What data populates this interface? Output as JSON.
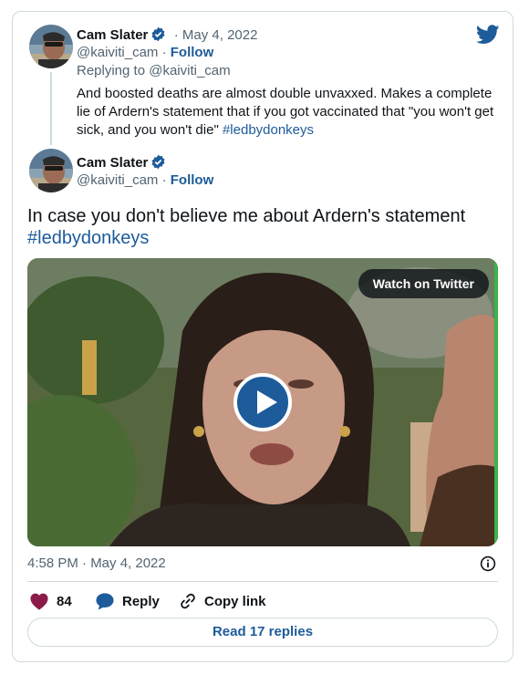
{
  "colors": {
    "accent": "#1d5b9a",
    "like": "#8b1c4a",
    "muted": "#536471",
    "border": "#cfd9de"
  },
  "reply_tweet": {
    "author_name": "Cam Slater",
    "date": "May 4, 2022",
    "handle": "@kaiviti_cam",
    "follow_label": "Follow",
    "replying_to": "Replying to @kaiviti_cam",
    "text": "And boosted deaths are almost double unvaxxed. Makes a complete lie of Ardern's statement that if you got vaccinated that \"you won't get sick, and you won't die\"",
    "hashtag": "#ledbydonkeys"
  },
  "main_tweet": {
    "author_name": "Cam Slater",
    "handle": "@kaiviti_cam",
    "follow_label": "Follow",
    "text": "In case you don't believe me about Ardern's statement",
    "hashtag": "#ledbydonkeys",
    "video": {
      "watch_label": "Watch on Twitter"
    },
    "timestamp": "4:58 PM · May 4, 2022",
    "likes": "84",
    "reply_label": "Reply",
    "copy_link_label": "Copy link",
    "read_replies_label": "Read 17 replies"
  },
  "icons": [
    "twitter-bird-icon",
    "verified-badge-icon",
    "play-icon",
    "info-icon",
    "heart-icon",
    "reply-bubble-icon",
    "link-icon"
  ]
}
